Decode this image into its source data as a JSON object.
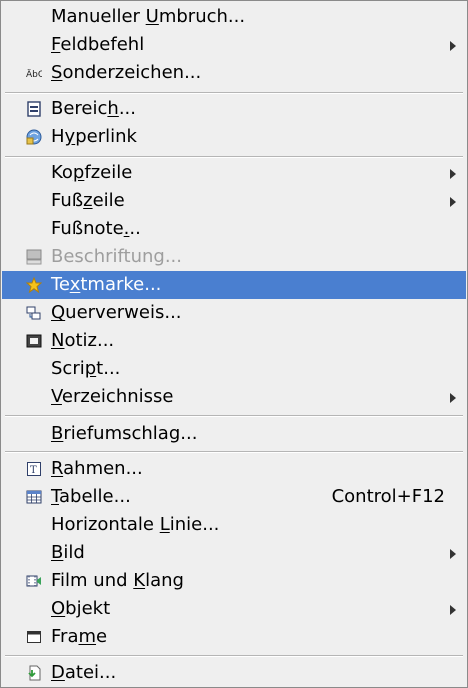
{
  "menu": {
    "colors": {
      "highlight": "#4a7fd0",
      "disabled_text": "#9e9e9e",
      "background": "#efefef"
    },
    "items": [
      {
        "label": "Manueller Umbruch...",
        "mnemonic": "U",
        "icon": "",
        "submenu": false
      },
      {
        "label": "Feldbefehl",
        "mnemonic": "F",
        "icon": "",
        "submenu": true
      },
      {
        "label": "Sonderzeichen...",
        "mnemonic": "S",
        "icon": "special-character-icon",
        "submenu": false
      },
      {
        "label": "Bereich...",
        "mnemonic": "h",
        "icon": "section-icon",
        "submenu": false
      },
      {
        "label": "Hyperlink",
        "mnemonic": "y",
        "icon": "hyperlink-icon",
        "submenu": false
      },
      {
        "label": "Kopfzeile",
        "mnemonic": "p",
        "icon": "",
        "submenu": true
      },
      {
        "label": "Fußzeile",
        "mnemonic": "z",
        "icon": "",
        "submenu": true
      },
      {
        "label": "Fußnote...",
        "mnemonic": ".",
        "icon": "",
        "submenu": false
      },
      {
        "label": "Beschriftung...",
        "mnemonic": "",
        "icon": "caption-icon",
        "submenu": false,
        "disabled": true
      },
      {
        "label": "Textmarke...",
        "mnemonic": "x",
        "icon": "bookmark-star-icon",
        "submenu": false,
        "selected": true
      },
      {
        "label": "Querverweis...",
        "mnemonic": "Q",
        "icon": "cross-reference-icon",
        "submenu": false
      },
      {
        "label": "Notiz...",
        "mnemonic": "N",
        "icon": "comment-icon",
        "submenu": false
      },
      {
        "label": "Script...",
        "mnemonic": "p",
        "icon": "",
        "submenu": false
      },
      {
        "label": "Verzeichnisse",
        "mnemonic": "V",
        "icon": "",
        "submenu": true
      },
      {
        "label": "Briefumschlag...",
        "mnemonic": "B",
        "icon": "",
        "submenu": false
      },
      {
        "label": "Rahmen...",
        "mnemonic": "R",
        "icon": "frame-icon",
        "submenu": false
      },
      {
        "label": "Tabelle...",
        "mnemonic": "T",
        "icon": "table-icon",
        "submenu": false,
        "shortcut": "Control+F12"
      },
      {
        "label": "Horizontale Linie...",
        "mnemonic": "L",
        "icon": "",
        "submenu": false
      },
      {
        "label": "Bild",
        "mnemonic": "B",
        "icon": "",
        "submenu": true
      },
      {
        "label": "Film und Klang",
        "mnemonic": "K",
        "icon": "movie-sound-icon",
        "submenu": false
      },
      {
        "label": "Objekt",
        "mnemonic": "O",
        "icon": "",
        "submenu": true
      },
      {
        "label": "Frame",
        "mnemonic": "m",
        "icon": "frame-window-icon",
        "submenu": false
      },
      {
        "label": "Datei...",
        "mnemonic": "D",
        "icon": "insert-file-icon",
        "submenu": false
      }
    ]
  }
}
